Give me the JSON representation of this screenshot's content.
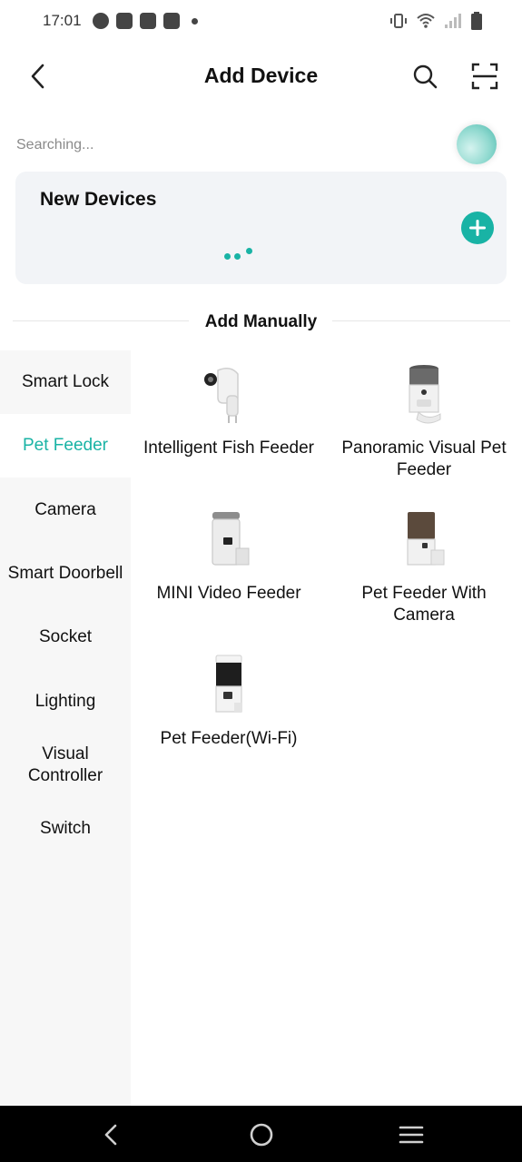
{
  "status_bar": {
    "time": "17:01",
    "notification_icons": [
      "alarm-icon",
      "bag-icon",
      "bag-icon",
      "bag-icon",
      "more-dot-icon"
    ],
    "right_icons": [
      "vibrate-icon",
      "wifi-icon",
      "signal-icon",
      "battery-icon"
    ]
  },
  "header": {
    "title": "Add Device",
    "back_icon": "chevron-left-icon",
    "search_icon": "search-icon",
    "scan_icon": "scan-icon"
  },
  "search": {
    "status_text": "Searching..."
  },
  "new_devices": {
    "title": "New Devices",
    "add_icon": "plus-circle-icon",
    "loading_icon": "loading-dots-icon"
  },
  "manual": {
    "label": "Add Manually"
  },
  "categories": [
    {
      "label": "Smart Lock",
      "active": false
    },
    {
      "label": "Pet Feeder",
      "active": true
    },
    {
      "label": "Camera",
      "active": false
    },
    {
      "label": "Smart Doorbell",
      "active": false
    },
    {
      "label": "Socket",
      "active": false
    },
    {
      "label": "Lighting",
      "active": false
    },
    {
      "label": "Visual Controller",
      "active": false
    },
    {
      "label": "Switch",
      "active": false
    }
  ],
  "devices": [
    {
      "name": "Intelligent Fish Feeder",
      "icon": "fish-feeder-image"
    },
    {
      "name": "Panoramic Visual Pet Feeder",
      "icon": "panoramic-feeder-image"
    },
    {
      "name": "MINI Video Feeder",
      "icon": "mini-video-feeder-image"
    },
    {
      "name": "Pet Feeder With Camera",
      "icon": "camera-feeder-image"
    },
    {
      "name": "Pet Feeder(Wi-Fi)",
      "icon": "wifi-feeder-image"
    }
  ],
  "nav_bar": {
    "icons": [
      "nav-back-icon",
      "nav-home-icon",
      "nav-recents-icon"
    ]
  },
  "colors": {
    "accent": "#19b3a5",
    "card_background": "#f2f4f7",
    "sidebar_background": "#f7f7f7"
  }
}
